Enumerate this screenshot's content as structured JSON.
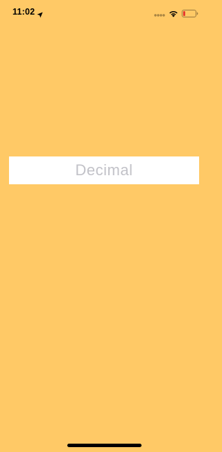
{
  "status_bar": {
    "time": "11:02",
    "icons": [
      "location-arrow-icon",
      "cellular-signal-icon",
      "wifi-icon",
      "battery-low-icon"
    ],
    "battery_color": "#E53B2F"
  },
  "main": {
    "decimal_field": {
      "value": "",
      "placeholder": "Decimal"
    }
  },
  "colors": {
    "background": "#FFC966",
    "field_background": "#FFFFFF",
    "placeholder": "#C2C2C8"
  }
}
